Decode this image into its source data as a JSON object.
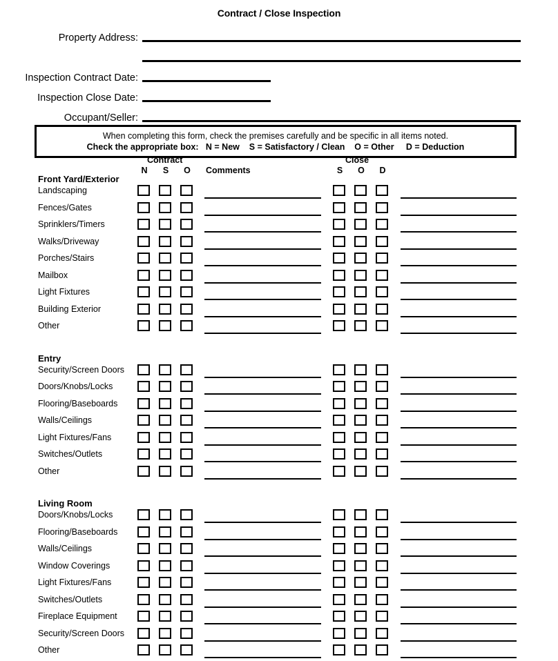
{
  "document": {
    "title": "Contract / Close Inspection"
  },
  "header_fields": [
    {
      "label": "Property Address:",
      "value": "",
      "rule": "long"
    },
    {
      "label": "",
      "value": "",
      "rule": "long"
    },
    {
      "label": "Inspection Contract Date:",
      "value": "",
      "rule": "short"
    },
    {
      "label": "Inspection Close Date:",
      "value": "",
      "rule": "short"
    },
    {
      "label": "Occupant/Seller:",
      "value": "",
      "rule": "long"
    }
  ],
  "instructions": {
    "line1": "When completing this form, check the premises carefully and be specific in all items noted.",
    "line2": "Check the appropriate box:   N = New    S = Satisfactory / Clean    O = Other     D = Deduction"
  },
  "columns": {
    "contract_group": "Contract",
    "close_group": "Close",
    "contract_letters": [
      "N",
      "S",
      "O"
    ],
    "close_letters": [
      "S",
      "O",
      "D"
    ],
    "comments_label": "Comments"
  },
  "sections": [
    {
      "heading": "Front Yard/Exterior",
      "items": [
        "Landscaping",
        "Fences/Gates",
        "Sprinklers/Timers",
        "Walks/Driveway",
        "Porches/Stairs",
        "Mailbox",
        "Light Fixtures",
        "Building Exterior",
        "Other"
      ]
    },
    {
      "heading": "Entry",
      "items": [
        "Security/Screen Doors",
        "Doors/Knobs/Locks",
        "Flooring/Baseboards",
        "Walls/Ceilings",
        "Light Fixtures/Fans",
        "Switches/Outlets",
        "Other"
      ]
    },
    {
      "heading": "Living Room",
      "items": [
        "Doors/Knobs/Locks",
        "Flooring/Baseboards",
        "Walls/Ceilings",
        "Window Coverings",
        "Light Fixtures/Fans",
        "Switches/Outlets",
        "Fireplace Equipment",
        "Security/Screen Doors",
        "Other"
      ]
    }
  ]
}
